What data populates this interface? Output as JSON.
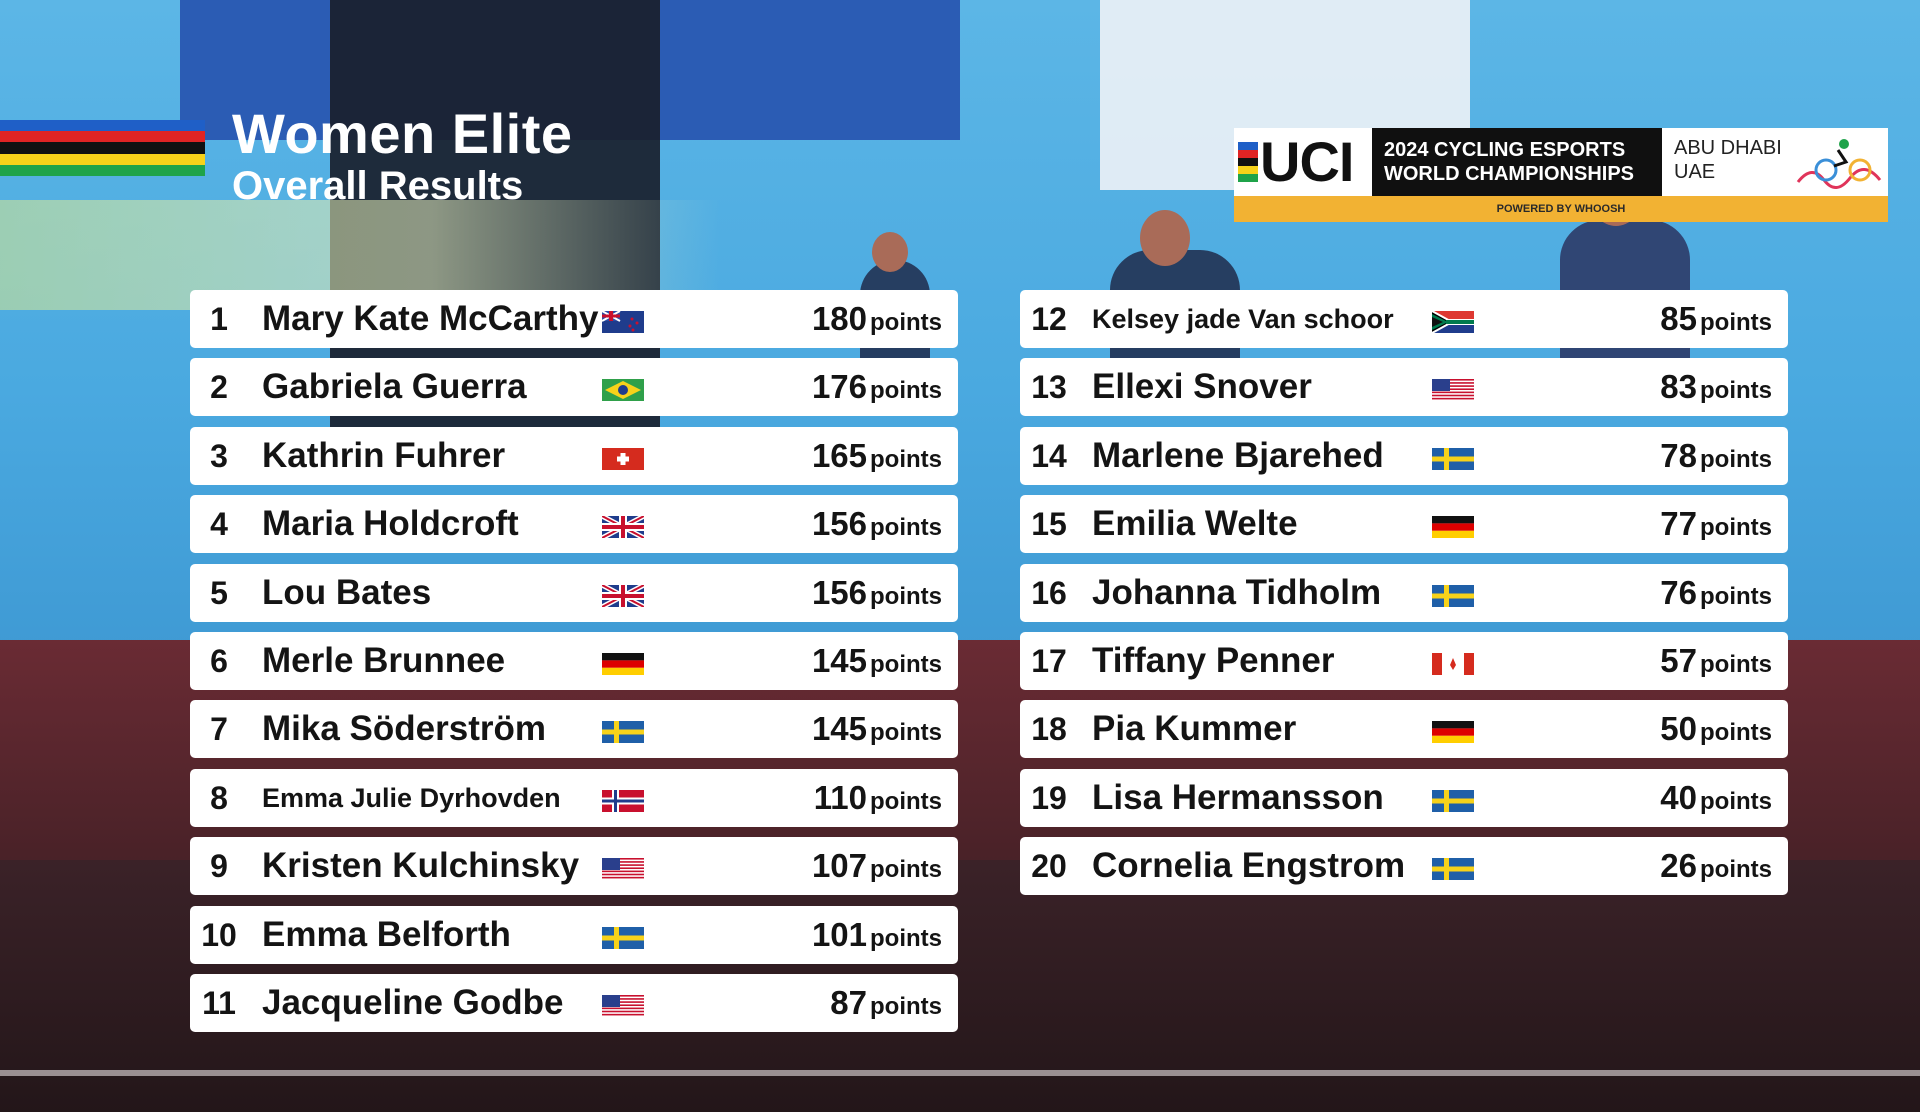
{
  "header": {
    "title": "Women Elite",
    "subtitle": "Overall Results"
  },
  "logo": {
    "org": "UCI",
    "event_line1": "2024 CYCLING ESPORTS",
    "event_line2": "WORLD CHAMPIONSHIPS",
    "location_line1": "ABU DHABI",
    "location_line2": "UAE",
    "powered_by": "POWERED BY WHOOSH"
  },
  "colors": {
    "rainbow": [
      "#1f5fc7",
      "#e02424",
      "#111111",
      "#f7d21a",
      "#1fa34a"
    ],
    "row_bg": "#ffffff",
    "logo_bar": "#f2b233"
  },
  "points_label": "points",
  "results": [
    {
      "rank": "1",
      "name": "Mary Kate McCarthy",
      "flag": "new-zealand",
      "points": "180"
    },
    {
      "rank": "2",
      "name": "Gabriela Guerra",
      "flag": "brazil",
      "points": "176"
    },
    {
      "rank": "3",
      "name": "Kathrin Fuhrer",
      "flag": "switzerland",
      "points": "165"
    },
    {
      "rank": "4",
      "name": "Maria Holdcroft",
      "flag": "great-britain",
      "points": "156"
    },
    {
      "rank": "5",
      "name": "Lou Bates",
      "flag": "great-britain",
      "points": "156"
    },
    {
      "rank": "6",
      "name": "Merle Brunnee",
      "flag": "germany",
      "points": "145"
    },
    {
      "rank": "7",
      "name": "Mika Söderström",
      "flag": "sweden",
      "points": "145"
    },
    {
      "rank": "8",
      "name": "Emma Julie Dyrhovden",
      "flag": "norway",
      "points": "110"
    },
    {
      "rank": "9",
      "name": "Kristen Kulchinsky",
      "flag": "usa",
      "points": "107"
    },
    {
      "rank": "10",
      "name": "Emma Belforth",
      "flag": "sweden",
      "points": "101"
    },
    {
      "rank": "11",
      "name": "Jacqueline Godbe",
      "flag": "usa",
      "points": "87"
    },
    {
      "rank": "12",
      "name": "Kelsey jade Van schoor",
      "flag": "south-africa",
      "points": "85"
    },
    {
      "rank": "13",
      "name": "Ellexi Snover",
      "flag": "usa",
      "points": "83"
    },
    {
      "rank": "14",
      "name": "Marlene Bjarehed",
      "flag": "sweden",
      "points": "78"
    },
    {
      "rank": "15",
      "name": "Emilia Welte",
      "flag": "germany",
      "points": "77"
    },
    {
      "rank": "16",
      "name": "Johanna Tidholm",
      "flag": "sweden",
      "points": "76"
    },
    {
      "rank": "17",
      "name": "Tiffany Penner",
      "flag": "canada",
      "points": "57"
    },
    {
      "rank": "18",
      "name": "Pia Kummer",
      "flag": "germany",
      "points": "50"
    },
    {
      "rank": "19",
      "name": "Lisa Hermansson",
      "flag": "sweden",
      "points": "40"
    },
    {
      "rank": "20",
      "name": "Cornelia Engstrom",
      "flag": "sweden",
      "points": "26"
    }
  ]
}
